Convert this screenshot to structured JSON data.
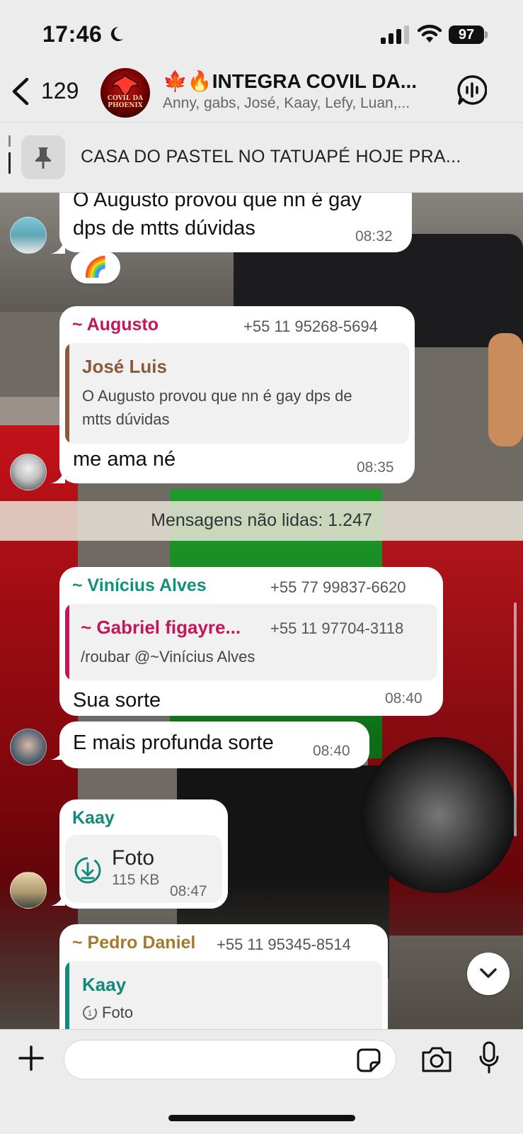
{
  "status_bar": {
    "time": "17:46",
    "battery": "97"
  },
  "header": {
    "back_count": "129",
    "avatar_text": "COVIL DA PHOENIX",
    "title": "🍁🔥INTEGRA COVIL DA...",
    "members": "Anny, gabs, José, Kaay, Lefy, Luan,..."
  },
  "pinned": {
    "text": "CASA DO PASTEL NO TATUAPÉ HOJE PRA..."
  },
  "messages": [
    {
      "line1": "O Augusto provou que nn é gay",
      "line2": "dps de mtts dúvidas",
      "time": "08:32",
      "reaction": "🌈"
    },
    {
      "sender": "~ Augusto",
      "phone": "+55 11 95268-5694",
      "quote": {
        "name": "José Luis",
        "line1": "O Augusto provou que nn é gay dps de",
        "line2": "mtts dúvidas"
      },
      "text": "me ama né",
      "time": "08:35"
    },
    {
      "sender": "~ Vinícius Alves",
      "phone": "+55 77 99837-6620",
      "quote": {
        "name": "~ Gabriel figayre...",
        "phone": "+55 11 97704-3118",
        "text": "/roubar @~Vinícius Alves"
      },
      "text": "Sua sorte",
      "time": "08:40"
    },
    {
      "text": "E mais profunda sorte",
      "time": "08:40"
    },
    {
      "sender": "Kaay",
      "file_title": "Foto",
      "file_size": "115 KB",
      "time": "08:47"
    },
    {
      "sender": "~ Pedro Daniel",
      "phone": "+55 11 95345-8514",
      "quote": {
        "name": "Kaay",
        "text": "Foto"
      }
    }
  ],
  "unread_banner": "Mensagens não lidas: 1.247",
  "composer": {
    "placeholder": ""
  },
  "colors": {
    "augusto": "#c2185b",
    "jose": "#8a5a3b",
    "vinicius": "#138f7d",
    "gabriel": "#c2185b",
    "kaay": "#13897a",
    "pedro": "#a57a2c"
  }
}
